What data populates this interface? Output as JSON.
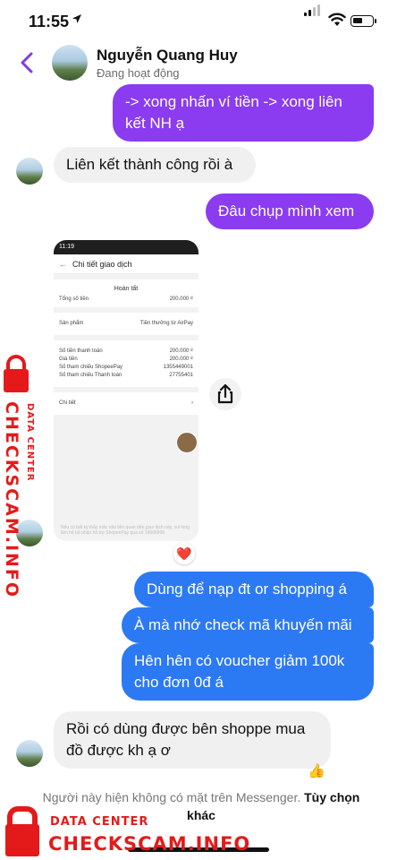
{
  "status_bar": {
    "time": "11:55"
  },
  "header": {
    "name": "Nguyễn Quang Huy",
    "status": "Đang hoạt động"
  },
  "messages": [
    {
      "from": "me",
      "text": "-> xong nhấn ví tiền -> xong liên kết NH ạ"
    },
    {
      "from": "them",
      "text": "Liên kết thành công rồi à"
    },
    {
      "from": "me",
      "text": "Đâu chụp mình xem"
    },
    {
      "from": "me",
      "text": "Dùng để nạp đt or shopping á"
    },
    {
      "from": "me",
      "text": "À mà nhớ check mã khuyến mãi"
    },
    {
      "from": "me",
      "text": "Hên hên có voucher giảm 100k cho đơn 0đ á"
    },
    {
      "from": "them",
      "text": "Rồi có dùng được bên shoppe mua đồ được kh ạ ơ"
    }
  ],
  "screenshot": {
    "time": "11:19",
    "title": "Chi tiết giao dịch",
    "status": "Hoàn tất",
    "rows_top": [
      {
        "label": "Tổng số tiền",
        "value": "200.000 ₫"
      }
    ],
    "rows_product": [
      {
        "label": "Sản phẩm",
        "value": "Tiền thưởng từ AirPay"
      }
    ],
    "rows_detail": [
      {
        "label": "Số tiền thanh toán",
        "value": "200.000 ₫"
      },
      {
        "label": "Giá tiền",
        "value": "200.000 ₫"
      },
      {
        "label": "Số tham chiếu ShopeePay",
        "value": "1355449001"
      },
      {
        "label": "Số tham chiếu Thanh toán",
        "value": "27755401"
      }
    ],
    "more_label": "Chi tiết",
    "footer": "Nếu có bất kỳ thắc mắc nào liên quan đến giao dịch này, vui lòng liên hệ bộ phận hỗ trợ ShopeePay qua số 19006906"
  },
  "reactions": {
    "heart": "❤️",
    "like": "👍"
  },
  "notice": {
    "text": "Người này hiện không có mặt trên Messenger.",
    "link": "Tùy chọn khác"
  },
  "watermark": {
    "brand": "CHECKSCAM.INFO",
    "sub": "DATA CENTER"
  },
  "colors": {
    "purple_bubble": "#8b3bf0",
    "blue_bubble": "#2c79f4",
    "accent": "#7b3fe4",
    "watermark": "#e41a1a"
  }
}
